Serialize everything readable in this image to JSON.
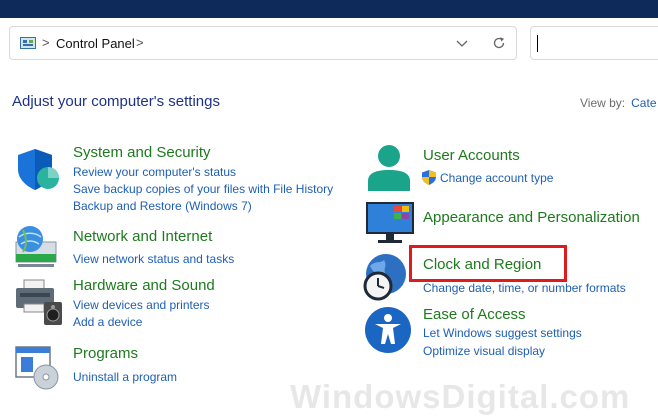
{
  "address": {
    "crumb": "Control Panel",
    "separator": ">"
  },
  "header": {
    "title": "Adjust your computer's settings",
    "view_by_label": "View by:",
    "view_by_value": "Cate"
  },
  "left": [
    {
      "title": "System and Security",
      "links": [
        "Review your computer's status",
        "Save backup copies of your files with File History",
        "Backup and Restore (Windows 7)"
      ]
    },
    {
      "title": "Network and Internet",
      "links": [
        "View network status and tasks"
      ]
    },
    {
      "title": "Hardware and Sound",
      "links": [
        "View devices and printers",
        "Add a device"
      ]
    },
    {
      "title": "Programs",
      "links": [
        "Uninstall a program"
      ]
    }
  ],
  "right": [
    {
      "title": "User Accounts",
      "links": [
        "Change account type"
      ]
    },
    {
      "title": "Appearance and Personalization",
      "links": []
    },
    {
      "title": "Clock and Region",
      "links": [
        "Change date, time, or number formats"
      ]
    },
    {
      "title": "Ease of Access",
      "links": [
        "Let Windows suggest settings",
        "Optimize visual display"
      ]
    }
  ],
  "watermark": "WindowsDigital.com",
  "colors": {
    "title_bar": "#0e2a5a",
    "category_title": "#1e7a1e",
    "link": "#1e5fb4",
    "heading": "#1e3287",
    "highlight": "#e01b1b"
  }
}
